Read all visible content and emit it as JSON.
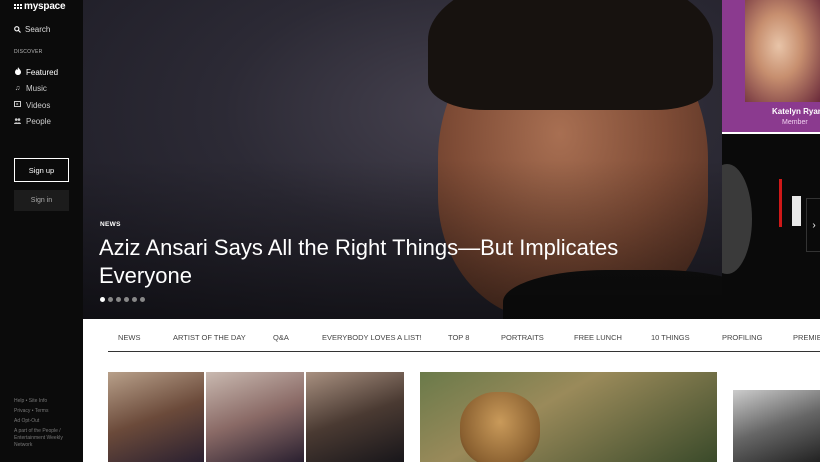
{
  "sidebar": {
    "logo": "myspace",
    "search_label": "Search",
    "section_label": "DISCOVER",
    "items": [
      {
        "label": "Featured",
        "icon": "flame-icon",
        "glyph": "🔥"
      },
      {
        "label": "Music",
        "icon": "music-note-icon",
        "glyph": "♫"
      },
      {
        "label": "Videos",
        "icon": "video-icon",
        "glyph": "▶"
      },
      {
        "label": "People",
        "icon": "people-icon",
        "glyph": "👥"
      }
    ],
    "signup_label": "Sign up",
    "signin_label": "Sign in",
    "footer": {
      "line1": "Help • Site Info",
      "line2": "Privacy • Terms",
      "line3": "Ad Opt-Out",
      "line4": "A part of the People / Entertainment Weekly Network"
    }
  },
  "hero": {
    "tag": "NEWS",
    "title": "Aziz Ansari Says All the Right Things—But Implicates Everyone",
    "slides": 6,
    "active_slide": 1
  },
  "side_card": {
    "name": "Katelyn Ryan",
    "role": "Member"
  },
  "categories": [
    "NEWS",
    "ARTIST OF THE DAY",
    "Q&A",
    "EVERYBODY LOVES A LIST!",
    "TOP 8",
    "PORTRAITS",
    "FREE LUNCH",
    "10 THINGS",
    "PROFILING",
    "PREMIERES"
  ],
  "colors": {
    "sidebar_bg": "#0b0b0b",
    "accent_purple": "#8b3a8f"
  }
}
